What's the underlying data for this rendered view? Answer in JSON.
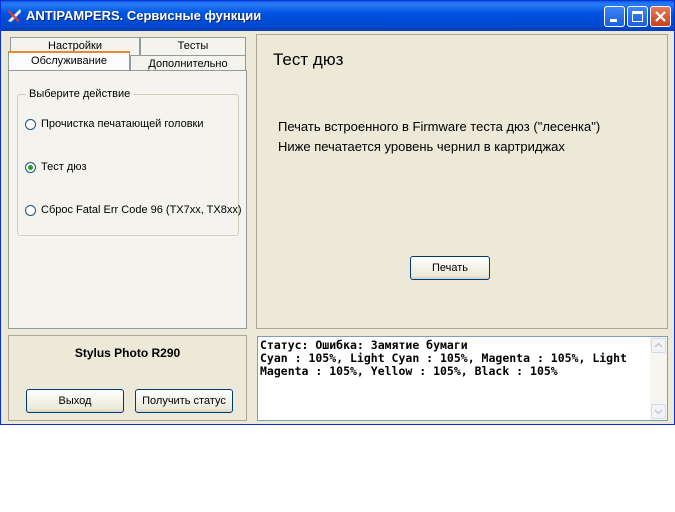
{
  "window": {
    "title": "ANTIPAMPERS. Сервисные функции"
  },
  "tabs": {
    "row1": [
      "Настройки",
      "Тесты"
    ],
    "row2": [
      "Обслуживание",
      "Дополнительно"
    ]
  },
  "group": {
    "legend": "Выберите действие",
    "options": [
      {
        "label": "Прочистка печатающей головки",
        "checked": false
      },
      {
        "label": "Тест дюз",
        "checked": true
      },
      {
        "label": "Сброс Fatal Err Code 96 (TX7xx, TX8xx)",
        "checked": false
      }
    ]
  },
  "main": {
    "heading": "Тест дюз",
    "line1": "Печать встроенного в Firmware теста дюз (\"лесенка\")",
    "line2": "Ниже печатается  уровень чернил в картриджах",
    "print_label": "Печать"
  },
  "footer": {
    "model": "Stylus Photo R290",
    "exit_label": "Выход",
    "status_button_label": "Получить статус"
  },
  "status": {
    "text": "Статус: Ошибка: Замятие бумаги\nCyan : 105%, Light Cyan : 105%, Magenta : 105%, Light Magenta : 105%, Yellow : 105%, Black : 105%"
  }
}
